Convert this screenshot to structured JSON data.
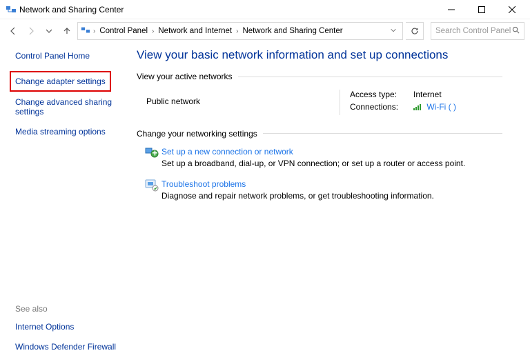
{
  "window": {
    "title": "Network and Sharing Center"
  },
  "breadcrumb": {
    "a": "Control Panel",
    "b": "Network and Internet",
    "c": "Network and Sharing Center"
  },
  "search": {
    "placeholder": "Search Control Panel"
  },
  "sidebar": {
    "home": "Control Panel Home",
    "adapter": "Change adapter settings",
    "advanced": "Change advanced sharing settings",
    "media": "Media streaming options",
    "see_also": "See also",
    "internet_options": "Internet Options",
    "firewall": "Windows Defender Firewall"
  },
  "main": {
    "title": "View your basic network information and set up connections",
    "view_active": "View your active networks",
    "net_name": "Public network",
    "access_label": "Access type:",
    "access_value": "Internet",
    "conn_label": "Connections:",
    "conn_value": "Wi-Fi (        )",
    "change_settings": "Change your networking settings",
    "setup_title": "Set up a new connection or network",
    "setup_desc": "Set up a broadband, dial-up, or VPN connection; or set up a router or access point.",
    "trouble_title": "Troubleshoot problems",
    "trouble_desc": "Diagnose and repair network problems, or get troubleshooting information."
  }
}
